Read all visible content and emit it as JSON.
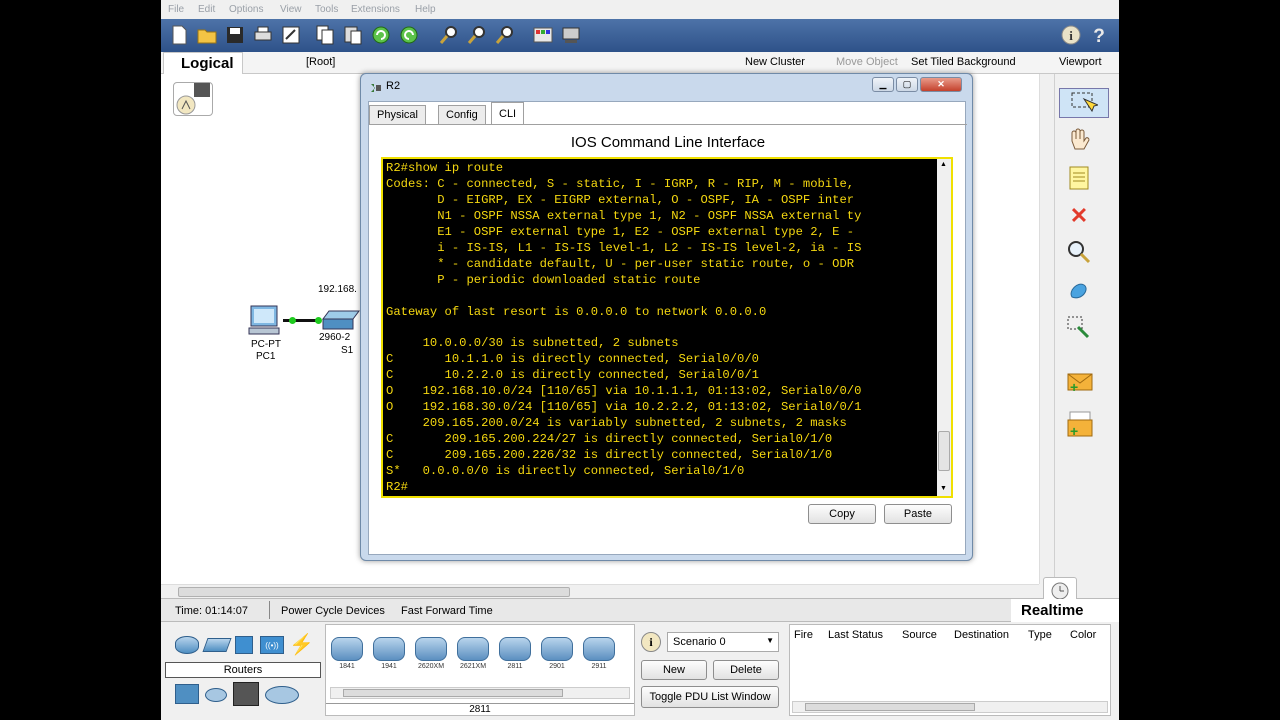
{
  "menu": [
    "File",
    "Edit",
    "Options",
    "View",
    "Tools",
    "Extensions",
    "Help"
  ],
  "logical_bar": {
    "tab": "Logical",
    "root": "[Root]",
    "new_cluster": "New Cluster",
    "move_object": "Move Object",
    "set_tiled_background": "Set Tiled Background",
    "viewport": "Viewport"
  },
  "topology": {
    "ip_label": "192.168.",
    "pc_type": "PC-PT",
    "pc_name": "PC1",
    "switch_type": "2960-2",
    "switch_name": "S1"
  },
  "dialog": {
    "title": "R2",
    "tabs": [
      "Physical",
      "Config",
      "CLI"
    ],
    "active_tab": "CLI",
    "heading": "IOS Command Line Interface",
    "terminal_lines": [
      "R2#show ip route",
      "Codes: C - connected, S - static, I - IGRP, R - RIP, M - mobile,",
      "       D - EIGRP, EX - EIGRP external, O - OSPF, IA - OSPF inter",
      "       N1 - OSPF NSSA external type 1, N2 - OSPF NSSA external ty",
      "       E1 - OSPF external type 1, E2 - OSPF external type 2, E -",
      "       i - IS-IS, L1 - IS-IS level-1, L2 - IS-IS level-2, ia - IS",
      "       * - candidate default, U - per-user static route, o - ODR",
      "       P - periodic downloaded static route",
      "",
      "Gateway of last resort is 0.0.0.0 to network 0.0.0.0",
      "",
      "     10.0.0.0/30 is subnetted, 2 subnets",
      "C       10.1.1.0 is directly connected, Serial0/0/0",
      "C       10.2.2.0 is directly connected, Serial0/0/1",
      "O    192.168.10.0/24 [110/65] via 10.1.1.1, 01:13:02, Serial0/0/0",
      "O    192.168.30.0/24 [110/65] via 10.2.2.2, 01:13:02, Serial0/0/1",
      "     209.165.200.0/24 is variably subnetted, 2 subnets, 2 masks",
      "C       209.165.200.224/27 is directly connected, Serial0/1/0",
      "C       209.165.200.226/32 is directly connected, Serial0/1/0",
      "S*   0.0.0.0/0 is directly connected, Serial0/1/0",
      "R2#"
    ],
    "copy_label": "Copy",
    "paste_label": "Paste"
  },
  "status": {
    "time": "Time: 01:14:07",
    "power_cycle": "Power Cycle Devices",
    "fast_forward": "Fast Forward Time",
    "mode": "Realtime"
  },
  "bottom": {
    "category": "Routers",
    "devices": [
      "1841",
      "1941",
      "2620XM",
      "2621XM",
      "2811",
      "2901",
      "2911"
    ],
    "selected_device": "2811",
    "scenario": "Scenario 0",
    "new_label": "New",
    "delete_label": "Delete",
    "toggle_pdu": "Toggle PDU List Window",
    "pdu_columns": [
      "Fire",
      "Last Status",
      "Source",
      "Destination",
      "Type",
      "Color"
    ]
  },
  "colors": {
    "toolbar": "#3a5f95",
    "terminal_bg": "#000000",
    "terminal_text": "#f5d810",
    "terminal_border": "#f0e000"
  }
}
